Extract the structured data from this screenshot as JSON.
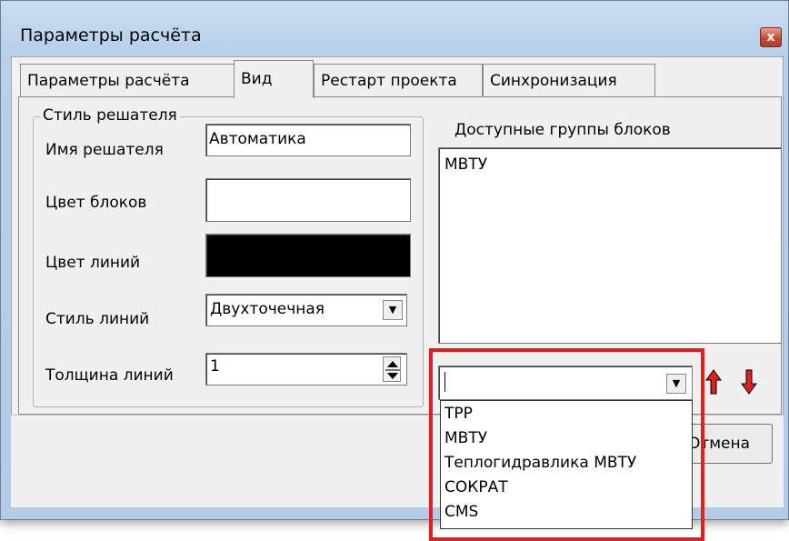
{
  "window": {
    "title": "Параметры расчёта",
    "close_label": "x"
  },
  "tabs": [
    {
      "label": "Параметры расчёта"
    },
    {
      "label": "Вид"
    },
    {
      "label": "Рестарт проекта"
    },
    {
      "label": "Синхронизация"
    }
  ],
  "solver_style": {
    "legend": "Стиль решателя",
    "solver_name_label": "Имя решателя",
    "solver_name_value": "Автоматика",
    "block_color_label": "Цвет блоков",
    "block_color": "#ffffff",
    "line_color_label": "Цвет линий",
    "line_color": "#000000",
    "line_style_label": "Стиль линий",
    "line_style_value": "Двухточечная",
    "line_width_label": "Толщина линий",
    "line_width_value": "1"
  },
  "block_groups": {
    "label": "Доступные группы блоков",
    "items": [
      "МВТУ"
    ],
    "combo_value": "",
    "dropdown_options": [
      "TPP",
      "МВТУ",
      "Теплогидравлика МВТУ",
      "СОКРАТ",
      "CMS"
    ]
  },
  "buttons": {
    "cancel_label": "Отмена"
  },
  "colors": {
    "highlight": "#e02020",
    "arrow": "#e02020"
  }
}
